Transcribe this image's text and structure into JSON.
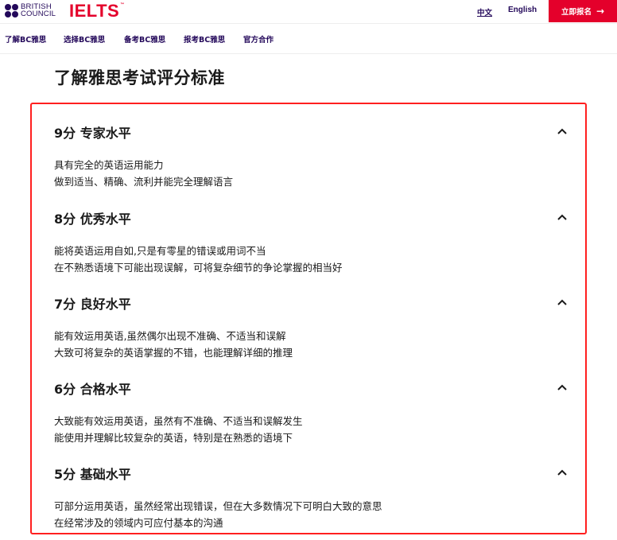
{
  "header": {
    "brand_line1": "BRITISH",
    "brand_line2": "COUNCIL",
    "ielts": "IELTS",
    "ielts_tm": "™",
    "lang_zh": "中文",
    "lang_en": "English",
    "cta": "立即报名",
    "cta_icon": "arrow-right-icon",
    "accent_color": "#e4002b",
    "brand_color": "#23085a"
  },
  "nav": {
    "items": [
      "了解BC雅思",
      "选择BC雅思",
      "备考BC雅思",
      "报考BC雅思",
      "官方合作"
    ]
  },
  "page": {
    "title": "了解雅思考试评分标准"
  },
  "bands": [
    {
      "title": "9分 专家水平",
      "lines": [
        "具有完全的英语运用能力",
        "做到适当、精确、流利并能完全理解语言"
      ],
      "icon": "chevron-up-icon"
    },
    {
      "title": "8分 优秀水平",
      "lines": [
        "能将英语运用自如,只是有零星的错误或用词不当",
        "在不熟悉语境下可能出现误解，可将复杂细节的争论掌握的相当好"
      ],
      "icon": "chevron-up-icon"
    },
    {
      "title": "7分 良好水平",
      "lines": [
        "能有效运用英语,虽然偶尔出现不准确、不适当和误解",
        "大致可将复杂的英语掌握的不错，也能理解详细的推理"
      ],
      "icon": "chevron-up-icon"
    },
    {
      "title": "6分 合格水平",
      "lines": [
        "大致能有效运用英语，虽然有不准确、不适当和误解发生",
        "能使用并理解比较复杂的英语，特别是在熟悉的语境下"
      ],
      "icon": "chevron-up-icon"
    },
    {
      "title": "5分 基础水平",
      "lines": [
        "可部分运用英语，虽然经常出现错误，但在大多数情况下可明白大致的意思",
        "在经常涉及的领域内可应付基本的沟通"
      ],
      "icon": "chevron-up-icon"
    }
  ]
}
